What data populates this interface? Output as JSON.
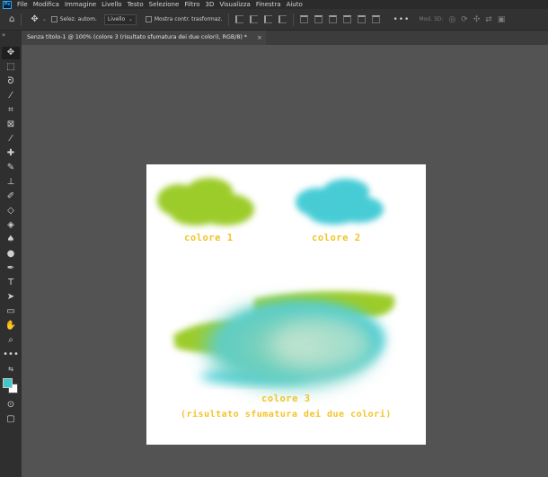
{
  "app": {
    "logo": "Ps"
  },
  "menu": [
    "File",
    "Modifica",
    "Immagine",
    "Livello",
    "Testo",
    "Selezione",
    "Filtro",
    "3D",
    "Visualizza",
    "Finestra",
    "Aiuto"
  ],
  "options": {
    "auto_select_label": "Selez. autom.",
    "layer_dropdown": "Livello",
    "transform_label": "Mostra contr. trasformaz.",
    "more": "•••",
    "mode_3d": "Mod. 3D:"
  },
  "toolbar": {
    "collapse": "»",
    "tools": [
      "move",
      "marquee",
      "lasso",
      "quick-select",
      "crop",
      "frame",
      "eyedropper",
      "healing",
      "brush",
      "stamp",
      "history-brush",
      "eraser",
      "gradient",
      "blur",
      "dodge",
      "pen",
      "type",
      "path-select",
      "shape",
      "hand",
      "zoom",
      "more"
    ],
    "extra": "•••"
  },
  "colors": {
    "foreground": "#3fc9c9",
    "background": "#ffffff",
    "green": "#9ccc2b",
    "cyan": "#46ccd6",
    "label": "#f5c326"
  },
  "document": {
    "tab_title": "Senza titolo-1 @ 100% (colore 3  (risultato sfumatura dei due colori), RGB/8) *",
    "close": "×"
  },
  "artwork": {
    "label1": "colore 1",
    "label2": "colore 2",
    "label3_line1": "colore 3",
    "label3_line2": "(risultato sfumatura dei due colori)"
  }
}
